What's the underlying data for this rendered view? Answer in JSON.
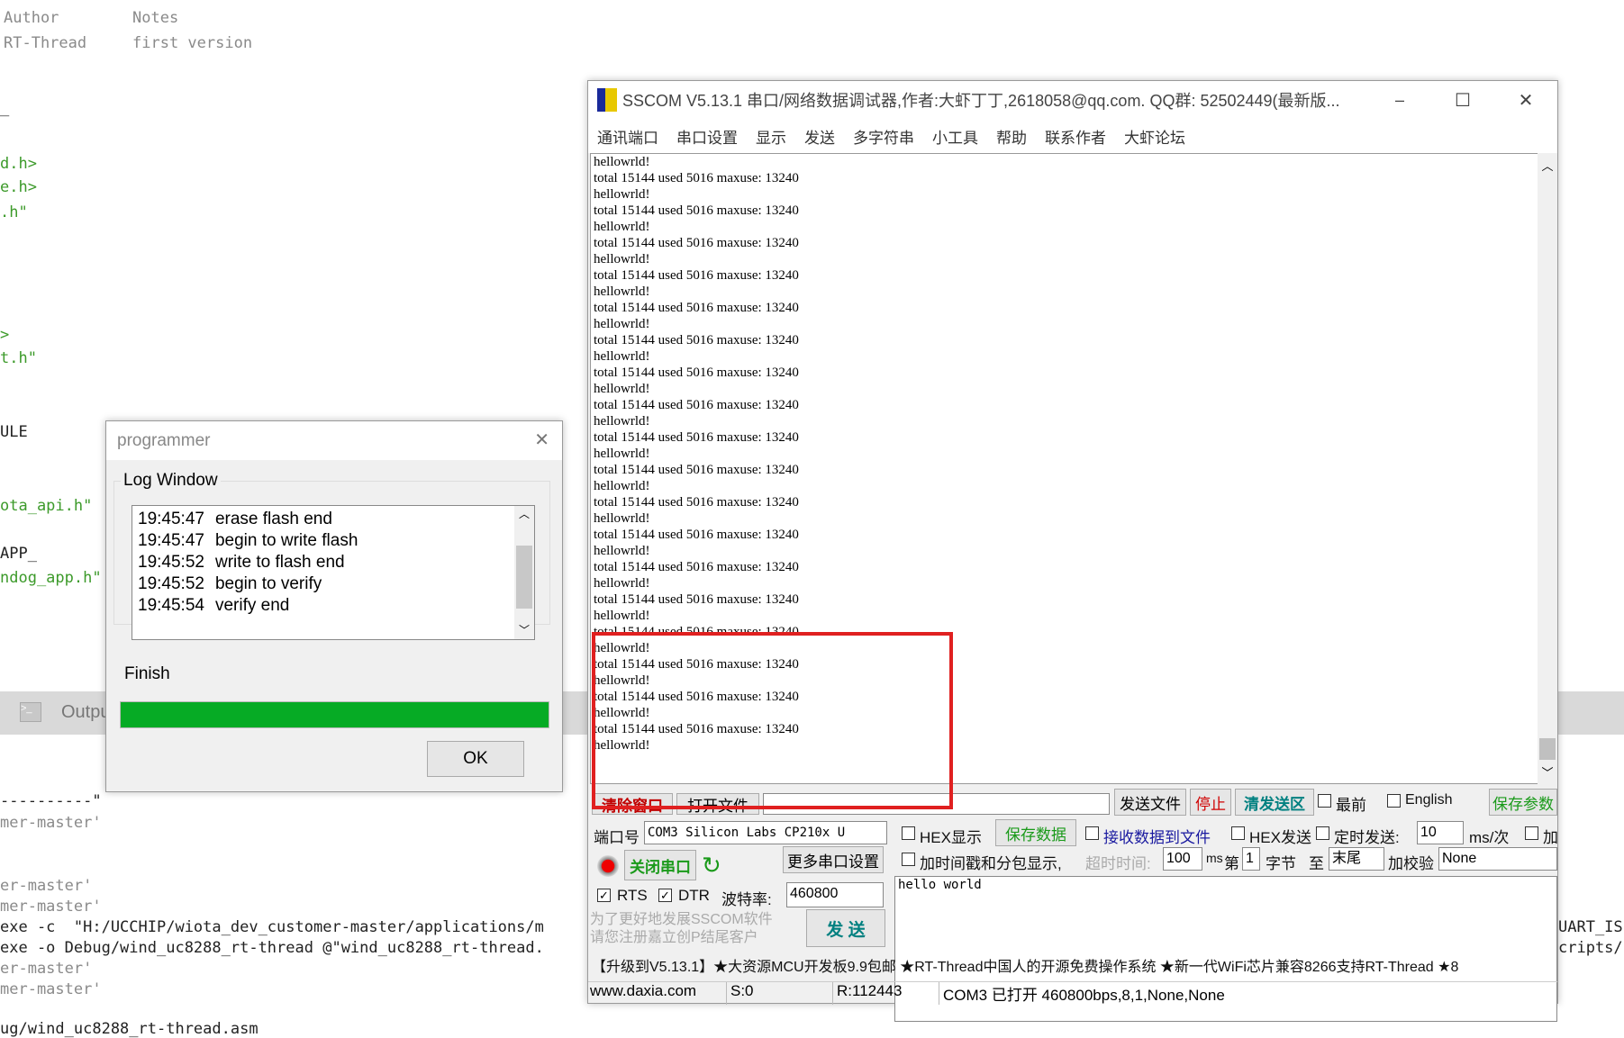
{
  "editor": {
    "header_cols": [
      "Author",
      "Notes"
    ],
    "header_vals": [
      "RT-Thread",
      "first version"
    ],
    "code_lines": [
      "_",
      "d.h>",
      "e.h>",
      ".h\"",
      ">",
      "t.h\"",
      "ULE",
      "ota_api.h\"",
      "APP_",
      "ndog_app.h\""
    ],
    "output_tab": "Outpu",
    "output_lines": [
      "----------\"",
      "mer-master'",
      "er-master'",
      "mer-master'",
      "exe -c  \"H:/UCCHIP/wiota_dev_customer-master/applications/m",
      "exe -o Debug/wind_uc8288_rt-thread @\"wind_uc8288_rt-thread.",
      "er-master'",
      "mer-master'",
      "ug/wind_uc8288_rt-thread.asm"
    ],
    "right_fragments": [
      "UART_IS",
      "cripts/"
    ]
  },
  "sscom": {
    "title": "SSCOM V5.13.1 串口/网络数据调试器,作者:大虾丁丁,2618058@qq.com. QQ群: 52502449(最新版...",
    "menu": [
      "通讯端口",
      "串口设置",
      "显示",
      "发送",
      "多字符串",
      "小工具",
      "帮助",
      "联系作者",
      "大虾论坛"
    ],
    "receive_lines": [
      "hellowrld!",
      "total 15144 used 5016 maxuse: 13240",
      "hellowrld!",
      "total 15144 used 5016 maxuse: 13240",
      "hellowrld!",
      "total 15144 used 5016 maxuse: 13240",
      "hellowrld!",
      "total 15144 used 5016 maxuse: 13240",
      "hellowrld!",
      "total 15144 used 5016 maxuse: 13240",
      "hellowrld!",
      "total 15144 used 5016 maxuse: 13240",
      "hellowrld!",
      "total 15144 used 5016 maxuse: 13240",
      "hellowrld!",
      "total 15144 used 5016 maxuse: 13240",
      "hellowrld!",
      "total 15144 used 5016 maxuse: 13240",
      "hellowrld!",
      "total 15144 used 5016 maxuse: 13240",
      "hellowrld!",
      "total 15144 used 5016 maxuse: 13240",
      "hellowrld!",
      "total 15144 used 5016 maxuse: 13240",
      "hellowrld!",
      "total 15144 used 5016 maxuse: 13240",
      "hellowrld!",
      "total 15144 used 5016 maxuse: 13240",
      "hellowrld!",
      "total 15144 used 5016 maxuse: 13240",
      "hellowrld!",
      "total 15144 used 5016 maxuse: 13240",
      "hellowrld!",
      "total 15144 used 5016 maxuse: 13240",
      "hellowrld!",
      "total 15144 used 5016 maxuse: 13240",
      "hellowrld!"
    ],
    "clear_window": "清除窗口",
    "open_file": "打开文件",
    "send_file": "发送文件",
    "stop": "停止",
    "clear_send": "清发送区",
    "topmost": "最前",
    "english": "English",
    "save_params": "保存参数",
    "port_label": "端口号",
    "port_value": "COM3 Silicon Labs CP210x U",
    "hex_display": "HEX显示",
    "save_data": "保存数据",
    "recv_to_file": "接收数据到文件",
    "hex_send": "HEX发送",
    "timed_send": "定时发送:",
    "interval": "10",
    "interval_unit": "ms/次",
    "add": "加",
    "close_port": "关闭串口",
    "more_settings": "更多串口设置",
    "timestamp": "加时间戳和分包显示,",
    "timeout_label": "超时时间:",
    "timeout": "100",
    "ms": "ms",
    "nth": "第",
    "byte_from": "1",
    "byte": "字节",
    "to": "至",
    "end": "末尾",
    "checksum": "加校验",
    "checksum_value": "None",
    "rts": "RTS",
    "dtr": "DTR",
    "baud_label": "波特率:",
    "baud": "460800",
    "send_text": "hello world",
    "promo": "为了更好地发展SSCOM软件\n请您注册嘉立创P结尾客户",
    "send": "发 送",
    "ticker": "【升级到V5.13.1】★大资源MCU开发板9.9包邮 ★RT-Thread中国人的开源免费操作系统 ★新一代WiFi芯片兼容8266支持RT-Thread ★8",
    "status": [
      "www.daxia.com",
      "S:0",
      "R:112443",
      "COM3 已打开  460800bps,8,1,None,None"
    ],
    "highlight_color": "#e02020"
  },
  "programmer": {
    "title": "programmer",
    "group": "Log Window",
    "log": [
      [
        "19:45:47",
        "erase flash end"
      ],
      [
        "19:45:47",
        "begin to write flash"
      ],
      [
        "19:45:52",
        "write to flash end"
      ],
      [
        "19:45:52",
        "begin to verify"
      ],
      [
        "19:45:54",
        "verify end"
      ]
    ],
    "status": "Finish",
    "progress_percent": 100,
    "progress_color": "#06ab25",
    "ok": "OK"
  }
}
